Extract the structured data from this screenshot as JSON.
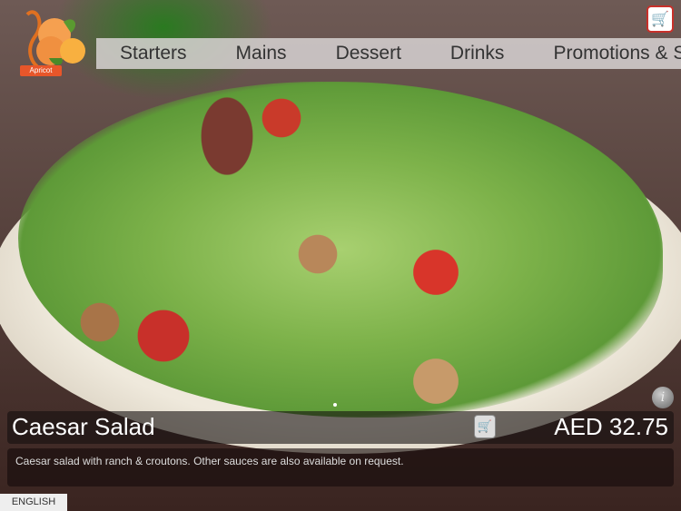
{
  "brand": {
    "logo_text": "Apricot"
  },
  "nav": {
    "items": [
      "Starters",
      "Mains",
      "Dessert",
      "Drinks",
      "Promotions & Specials"
    ]
  },
  "item": {
    "name": "Caesar Salad",
    "price": "AED 32.75",
    "description": "Caesar salad with ranch & croutons. Other sauces are also available on request."
  },
  "language": {
    "label": "ENGLISH"
  },
  "icons": {
    "cart": "cart-icon",
    "info": "info-icon"
  },
  "colors": {
    "accent": "#c8302a",
    "logo_orange": "#e8562a"
  }
}
